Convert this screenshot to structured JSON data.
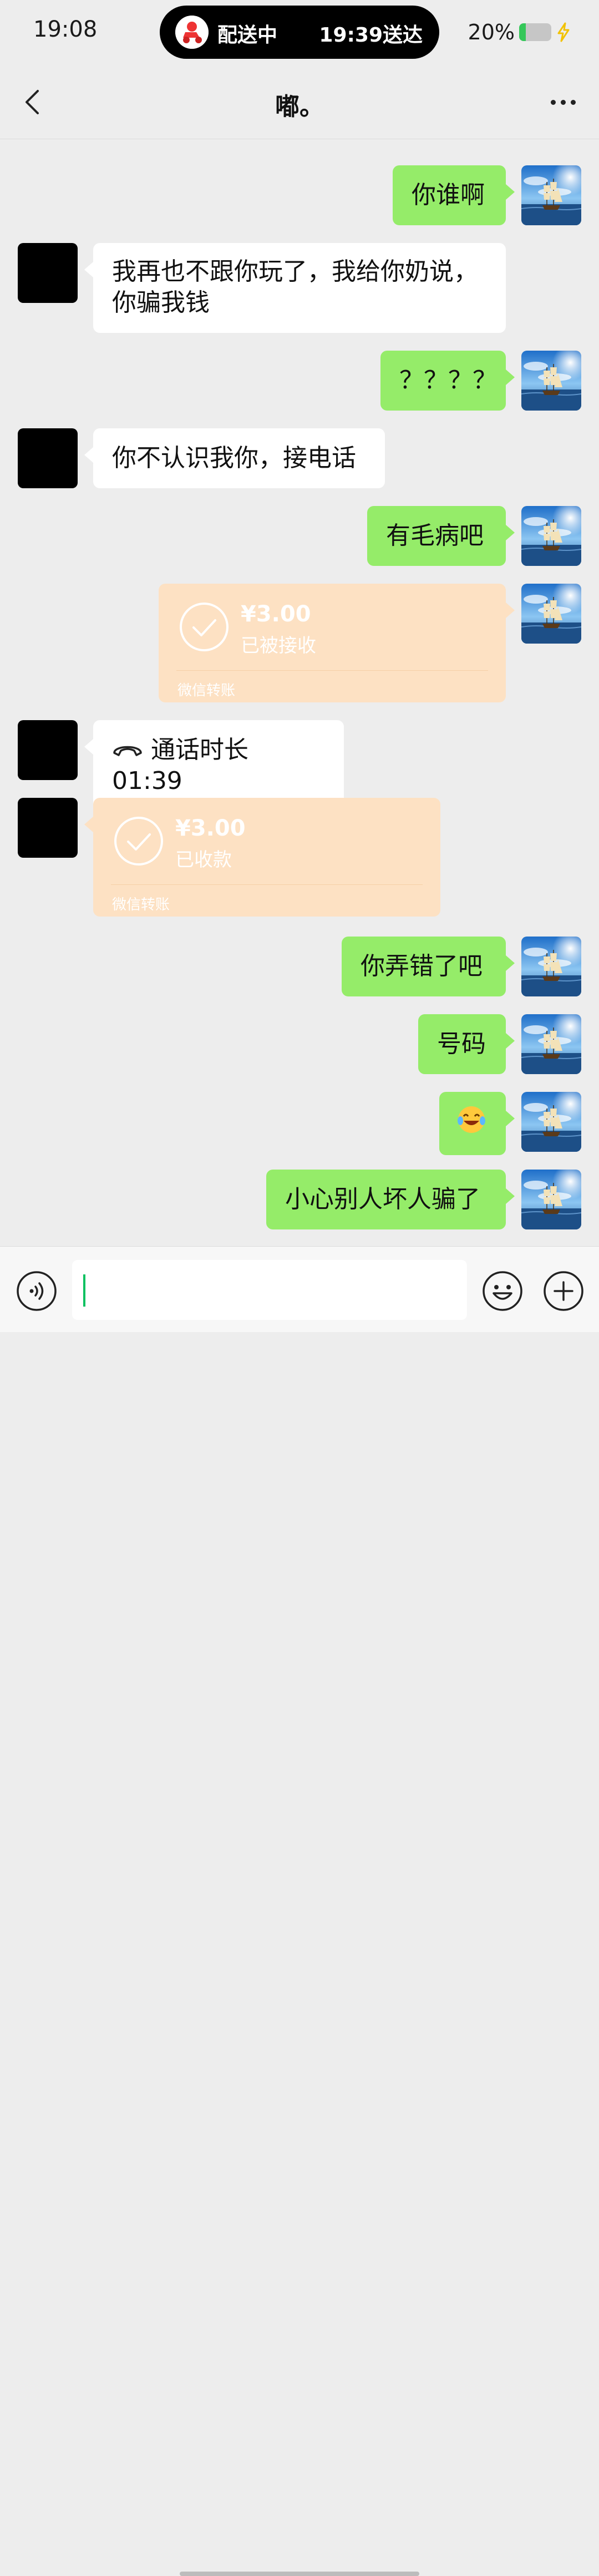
{
  "status_bar": {
    "time": "19:08",
    "delivery_status": "配送中",
    "delivery_eta": "19:39送达",
    "battery_percent": "20%",
    "battery_level": 0.2,
    "battery_color": "#35c759"
  },
  "nav": {
    "title": "嘟。",
    "back_icon": "chevron-left-icon",
    "more_icon": "more-horizontal-icon"
  },
  "messages": [
    {
      "from": "me",
      "type": "text",
      "text": "你谁啊"
    },
    {
      "from": "other",
      "type": "text",
      "lines": [
        "我再也不跟你玩了，我给你奶说，",
        "你骗我钱"
      ]
    },
    {
      "from": "me",
      "type": "text",
      "text": "？？？？"
    },
    {
      "from": "other",
      "type": "text",
      "text": "你不认识我你，接电话"
    },
    {
      "from": "me",
      "type": "text",
      "text": "有毛病吧"
    },
    {
      "from": "me",
      "type": "transfer",
      "amount": "¥3.00",
      "status": "已被接收",
      "label": "微信转账"
    },
    {
      "from": "other",
      "type": "call",
      "text": "通话时长 01:39"
    },
    {
      "from": "other",
      "type": "transfer",
      "amount": "¥3.00",
      "status": "已收款",
      "label": "微信转账"
    },
    {
      "from": "me",
      "type": "text",
      "text": "你弄错了吧"
    },
    {
      "from": "me",
      "type": "text",
      "text": "号码"
    },
    {
      "from": "me",
      "type": "emoji",
      "emoji": "😂"
    },
    {
      "from": "me",
      "type": "text",
      "text": "小心别人坏人骗了"
    }
  ],
  "input_bar": {
    "voice_icon": "voice-icon",
    "emoji_icon": "emoji-smile-icon",
    "plus_icon": "plus-circle-icon",
    "value": ""
  },
  "colors": {
    "my_bubble": "#95ec69",
    "other_bubble": "#ffffff",
    "transfer_card": "#fde1c3",
    "background": "#ededed"
  }
}
